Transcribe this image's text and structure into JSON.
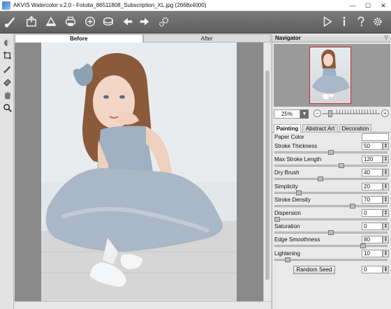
{
  "window": {
    "title": "AKVIS Watercolor v.2.0 - Fotolia_86511808_Subscription_XL.jpg (2668x4000)",
    "minimize": "—",
    "maximize": "☐",
    "close": "✕"
  },
  "toolbar": {
    "icons": [
      "watercolor-logo-icon",
      "open-image-icon",
      "save-image-icon",
      "print-icon",
      "share-icon",
      "batch-icon",
      "undo-icon",
      "redo-icon",
      "settings-gear-icon",
      "run-icon",
      "info-icon",
      "help-icon",
      "preferences-icon"
    ]
  },
  "tools": {
    "icons": [
      "before-after-icon",
      "crop-icon",
      "brush-icon",
      "eraser-icon",
      "hand-icon",
      "zoom-icon"
    ]
  },
  "view_tabs": {
    "before": "Before",
    "after": "After",
    "active": "Before"
  },
  "navigator": {
    "title": "Navigator",
    "zoom_value": "25%",
    "zoom_level": 0.1
  },
  "settings_tabs": [
    "Painting",
    "Abstract Art",
    "Decoration"
  ],
  "active_settings_tab": "Painting",
  "params": {
    "paper_color_label": "Paper Color",
    "paper_color": "#ffffff",
    "items": [
      {
        "label": "Stroke Thickness",
        "value": "50",
        "level": 0.5
      },
      {
        "label": "Max Stroke Length",
        "value": "120",
        "level": 0.6
      },
      {
        "label": "Dry Brush",
        "value": "40",
        "level": 0.4
      },
      {
        "label": "Simplicity",
        "value": "20",
        "level": 0.2
      },
      {
        "label": "Stroke Density",
        "value": "70",
        "level": 0.7
      },
      {
        "label": "Dispersion",
        "value": "0",
        "level": 0.0
      },
      {
        "label": "Saturation",
        "value": "0",
        "level": 0.5
      },
      {
        "label": "Edge Smoothness",
        "value": "80",
        "level": 0.8
      },
      {
        "label": "Lightening",
        "value": "10",
        "level": 0.1
      }
    ]
  },
  "random_seed": {
    "label": "Random Seed",
    "value": "0"
  },
  "colors": {
    "toolbar": "#6b6b6b",
    "navigator_frame": "#cc2b2b",
    "canvas_bg": "#8a8a8a"
  }
}
